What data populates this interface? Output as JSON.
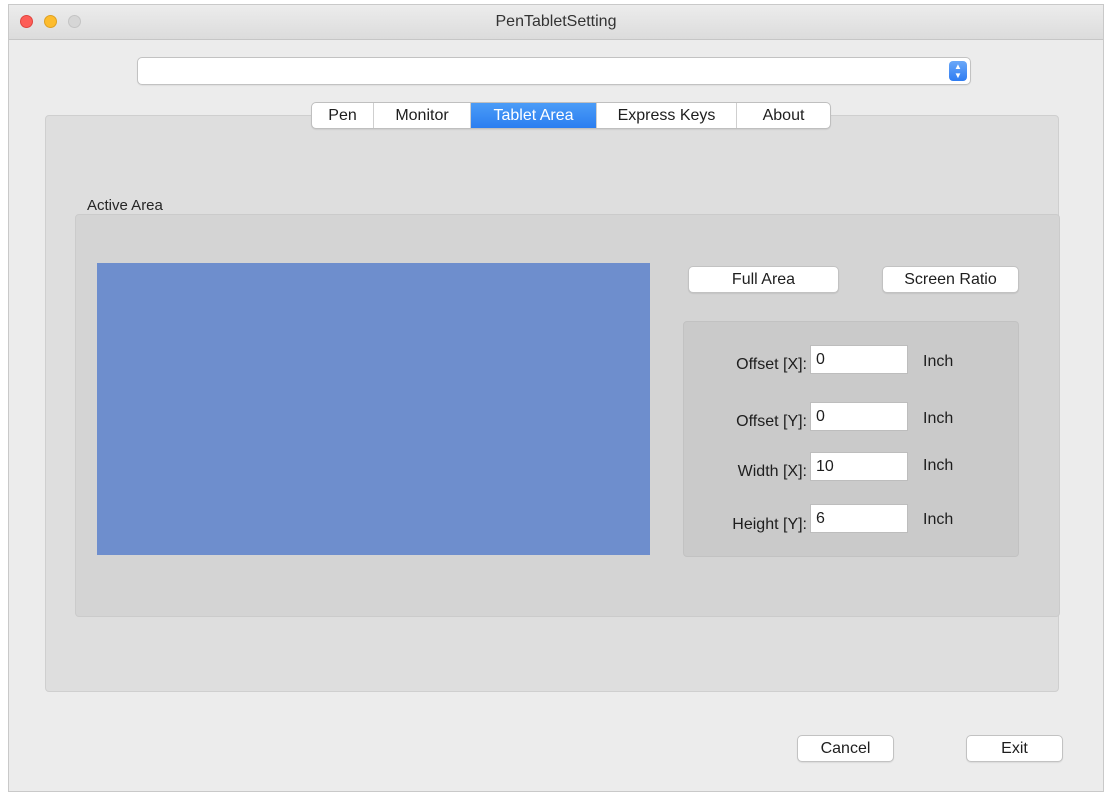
{
  "window": {
    "title": "PenTabletSetting"
  },
  "device_select": {
    "value": ""
  },
  "tabs": [
    {
      "label": "Pen",
      "active": false
    },
    {
      "label": "Monitor",
      "active": false
    },
    {
      "label": "Tablet Area",
      "active": true
    },
    {
      "label": "Express Keys",
      "active": false
    },
    {
      "label": "About",
      "active": false
    }
  ],
  "active_area": {
    "label": "Active Area",
    "preview_color": "#6e8ecd",
    "full_area_label": "Full Area",
    "screen_ratio_label": "Screen Ratio",
    "fields": [
      {
        "label": "Offset [X]:",
        "value": "0",
        "unit": "Inch"
      },
      {
        "label": "Offset [Y]:",
        "value": "0",
        "unit": "Inch"
      },
      {
        "label": "Width [X]:",
        "value": "10",
        "unit": "Inch"
      },
      {
        "label": "Height [Y]:",
        "value": "6",
        "unit": "Inch"
      }
    ]
  },
  "footer": {
    "cancel_label": "Cancel",
    "exit_label": "Exit"
  },
  "colors": {
    "accent": "#2b7ef0",
    "window_bg": "#ececec"
  }
}
